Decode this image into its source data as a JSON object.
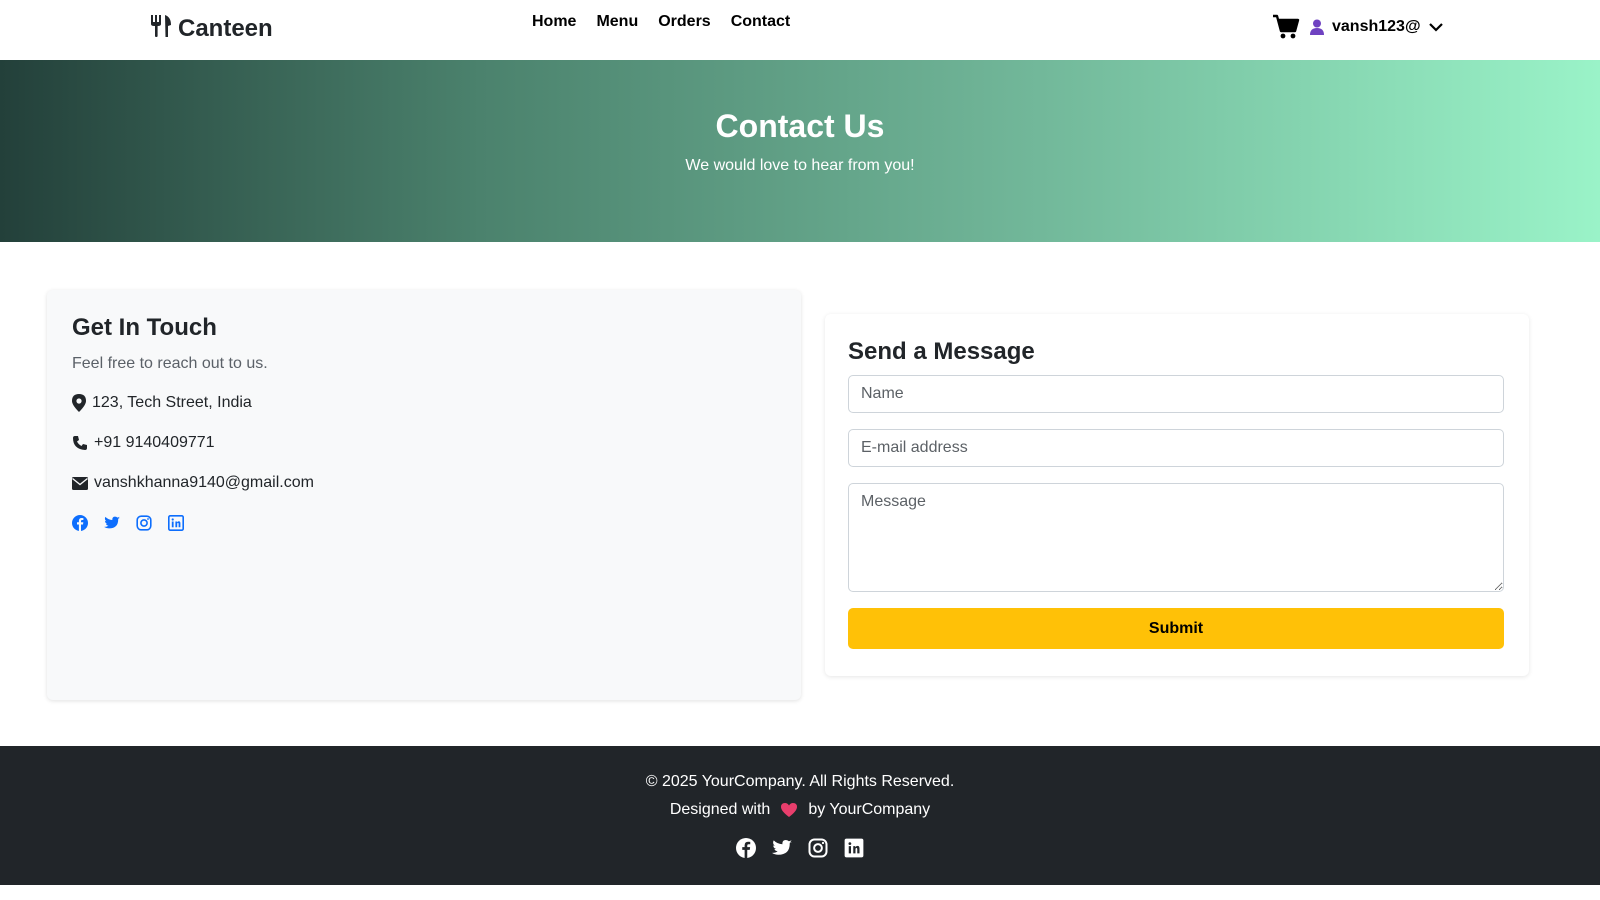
{
  "navbar": {
    "brand": "Canteen",
    "brand_icon": "utensils-icon",
    "links": [
      "Home",
      "Menu",
      "Orders",
      "Contact"
    ],
    "cart_icon": "cart-icon",
    "user_icon": "user-icon",
    "user_name": "vansh123@",
    "dropdown_icon": "chevron-down-icon"
  },
  "hero": {
    "title": "Contact Us",
    "subtitle": "We would love to hear from you!"
  },
  "contact_info": {
    "title": "Get In Touch",
    "subtitle": "Feel free to reach out to us.",
    "address": "123, Tech Street, India",
    "phone": "+91 9140409771",
    "email": "vanshkhanna9140@gmail.com",
    "socials": [
      "facebook-icon",
      "twitter-icon",
      "instagram-icon",
      "linkedin-icon"
    ]
  },
  "form": {
    "title": "Send a Message",
    "name_placeholder": "Name",
    "email_placeholder": "E-mail address",
    "message_placeholder": "Message",
    "submit_label": "Submit"
  },
  "footer": {
    "copyright": "© 2025 YourCompany. All Rights Reserved.",
    "designed_prefix": "Designed with",
    "designed_suffix": "by YourCompany",
    "socials": [
      "facebook-icon",
      "twitter-icon",
      "instagram-icon",
      "linkedin-icon"
    ]
  },
  "colors": {
    "accent": "#ffc107",
    "social_blue": "#0d6efd",
    "footer_bg": "#212529",
    "user_icon": "#6f42c1",
    "heart": "#e83e6c"
  }
}
